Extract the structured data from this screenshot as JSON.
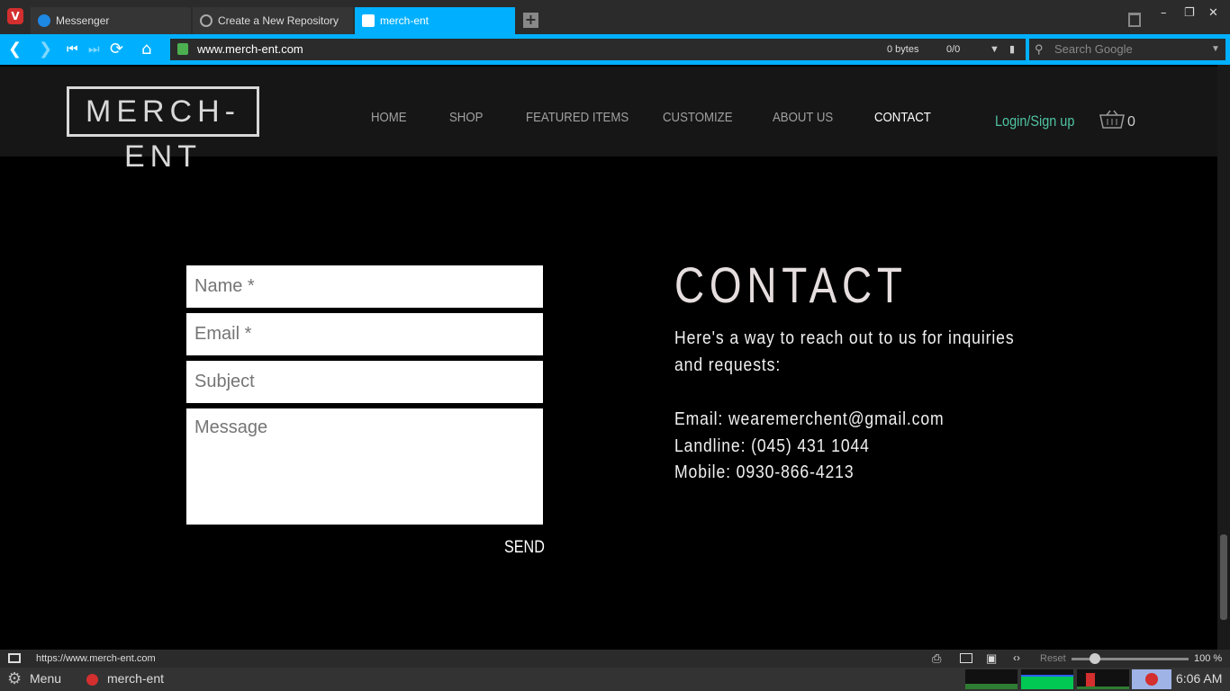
{
  "browser": {
    "tabs": [
      {
        "label": "Messenger"
      },
      {
        "label": "Create a New Repository"
      },
      {
        "label": "merch-ent"
      }
    ],
    "url": "www.merch-ent.com",
    "bytes": "0 bytes",
    "counter": "0/0",
    "search_placeholder": "Search Google",
    "status_url": "https://www.merch-ent.com",
    "reset_label": "Reset",
    "zoom": "100 %"
  },
  "site": {
    "logo": "MERCH-ENT",
    "nav": [
      "HOME",
      "SHOP",
      "FEATURED ITEMS",
      "CUSTOMIZE",
      "ABOUT US",
      "CONTACT"
    ],
    "login": "Login/Sign up",
    "cart_count": "0"
  },
  "form": {
    "name_placeholder": "Name *",
    "email_placeholder": "Email *",
    "subject_placeholder": "Subject",
    "message_placeholder": "Message",
    "send_label": "SEND"
  },
  "contact": {
    "title": "CONTACT",
    "intro_line1": "Here's a way to reach out to us for inquiries",
    "intro_line2": "and requests:",
    "email": "Email: wearemerchent@gmail.com",
    "landline": "Landline: (045) 431 1044",
    "mobile": "Mobile: 0930-866-4213"
  },
  "taskbar": {
    "menu_label": "Menu",
    "app_label": "merch-ent",
    "time": "6:06 AM"
  },
  "colors": {
    "accent": "#00b0ff",
    "login": "#4fc3a1",
    "page_bg": "#000000",
    "header_bg": "#161616"
  }
}
